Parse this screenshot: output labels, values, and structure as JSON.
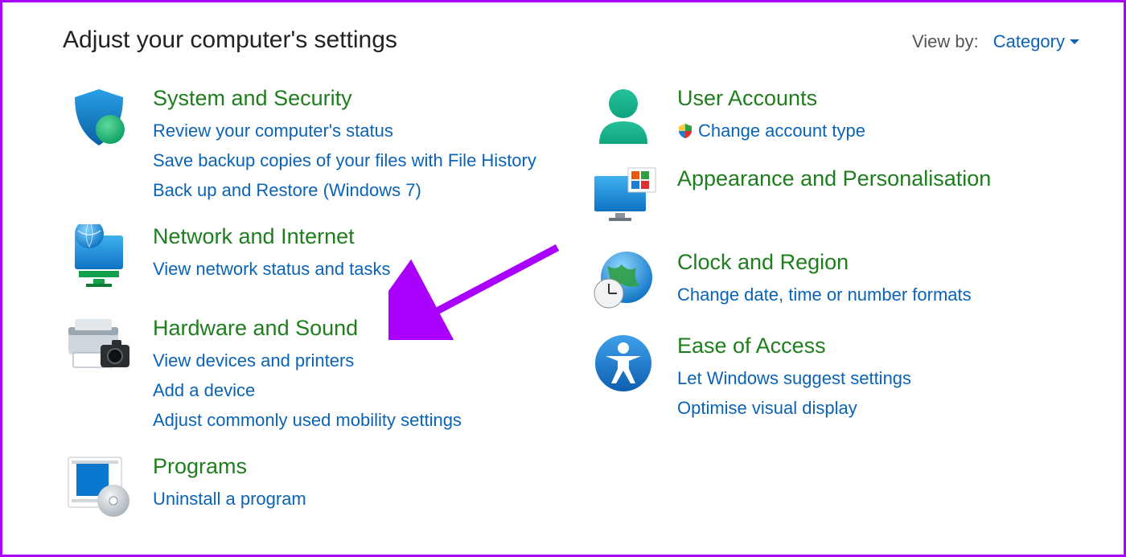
{
  "header": {
    "title": "Adjust your computer's settings",
    "viewby_label": "View by:",
    "viewby_value": "Category"
  },
  "left": {
    "system": {
      "title": "System and Security",
      "links": [
        "Review your computer's status",
        "Save backup copies of your files with File History",
        "Back up and Restore (Windows 7)"
      ]
    },
    "network": {
      "title": "Network and Internet",
      "links": [
        "View network status and tasks"
      ]
    },
    "hardware": {
      "title": "Hardware and Sound",
      "links": [
        "View devices and printers",
        "Add a device",
        "Adjust commonly used mobility settings"
      ]
    },
    "programs": {
      "title": "Programs",
      "links": [
        "Uninstall a program"
      ]
    }
  },
  "right": {
    "user": {
      "title": "User Accounts",
      "links": [
        "Change account type"
      ]
    },
    "appearance": {
      "title": "Appearance and Personalisation"
    },
    "clock": {
      "title": "Clock and Region",
      "links": [
        "Change date, time or number formats"
      ]
    },
    "ease": {
      "title": "Ease of Access",
      "links": [
        "Let Windows suggest settings",
        "Optimise visual display"
      ]
    }
  }
}
